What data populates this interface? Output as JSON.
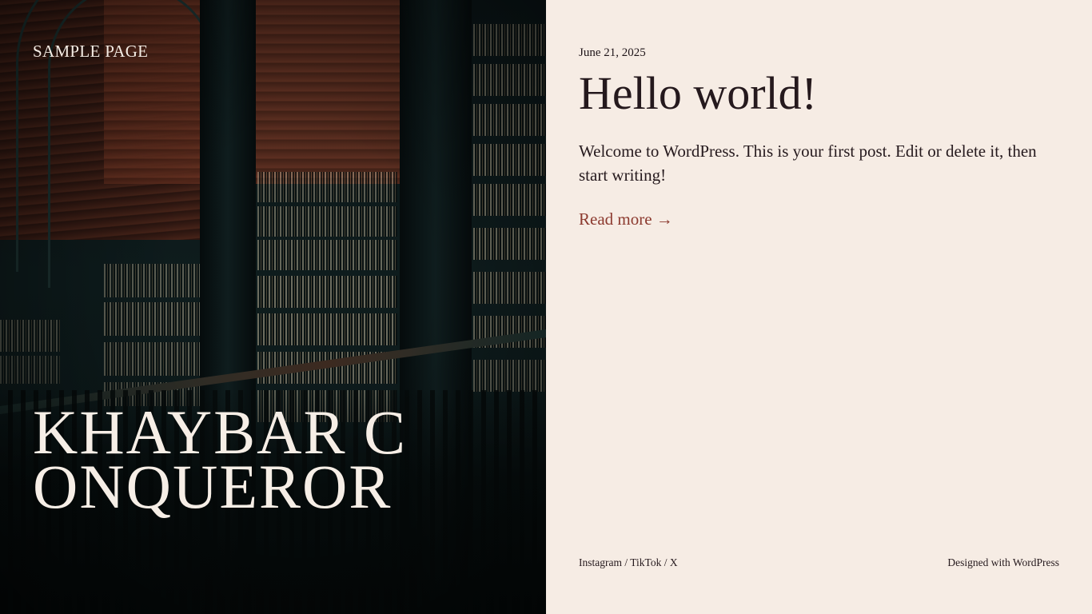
{
  "hero": {
    "nav_link": "SAMPLE PAGE",
    "site_title": "KHAYBAR CONQUEROR"
  },
  "post": {
    "date": "June 21, 2025",
    "title": "Hello world!",
    "excerpt": "Welcome to WordPress. This is your first post. Edit or delete it, then start writing!",
    "read_more": "Read more →"
  },
  "footer": {
    "social": [
      "Instagram",
      "TikTok",
      "X"
    ],
    "separator": " / ",
    "credit_prefix": "Designed with ",
    "credit_link": "WordPress"
  },
  "colors": {
    "content_bg": "#f6ece4",
    "text": "#25191d",
    "accent_link": "#8c3a2f",
    "hero_text": "#f6eee6"
  }
}
